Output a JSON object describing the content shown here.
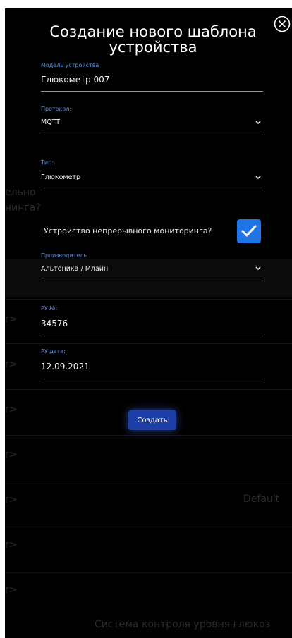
{
  "dialog": {
    "title": "Создание нового шаблона устройства",
    "submit_label": "Создать"
  },
  "fields": {
    "model": {
      "label": "Модель устройства",
      "value": "Глюкометр 007"
    },
    "protocol": {
      "label": "Протокол:",
      "value": "MQTT"
    },
    "type": {
      "label": "Тип:",
      "value": "Глюкометр"
    },
    "continuous": {
      "label": "Устройство непрерывного мониторинга?",
      "checked": true
    },
    "manufacturer": {
      "label": "Производитель",
      "value": "Альтоника / Млайн"
    },
    "ru_number": {
      "label": "РУ №:",
      "value": "34576"
    },
    "ru_date": {
      "label": "РУ дата:",
      "value": "12.09.2021"
    }
  },
  "background": {
    "left_fragment_1": "ельно",
    "left_fragment_2": "нинга?",
    "row_marker": "r>",
    "right_fragment": "Default",
    "bottom_fragment": "Система контроля уровня глюкоз"
  },
  "colors": {
    "accent_label": "#5f8fd0",
    "checkbox": "#1f74e6",
    "button": "#1f3fa8",
    "background": "#000000"
  },
  "icons": {
    "close": "close-circle-icon",
    "dropdown": "chevron-down-icon",
    "check": "checkmark-icon"
  }
}
